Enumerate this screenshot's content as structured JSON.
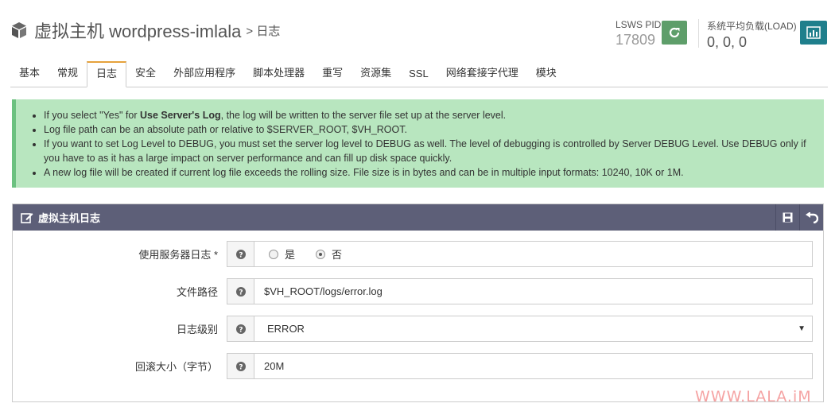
{
  "header": {
    "title": "虚拟主机 wordpress-imlala",
    "sub": "> 日志",
    "pid_label": "LSWS PID",
    "pid_value": "17809",
    "load_label": "系统平均负载(LOAD)",
    "load_value": "0, 0, 0"
  },
  "tabs": [
    {
      "label": "基本"
    },
    {
      "label": "常规"
    },
    {
      "label": "日志"
    },
    {
      "label": "安全"
    },
    {
      "label": "外部应用程序"
    },
    {
      "label": "脚本处理器"
    },
    {
      "label": "重写"
    },
    {
      "label": "资源集"
    },
    {
      "label": "SSL"
    },
    {
      "label": "网络套接字代理"
    },
    {
      "label": "模块"
    }
  ],
  "info": {
    "line1_pre": "If you select \"Yes\" for ",
    "line1_bold": "Use Server's Log",
    "line1_post": ", the log will be written to the server file set up at the server level.",
    "line2": "Log file path can be an absolute path or relative to $SERVER_ROOT, $VH_ROOT.",
    "line3": "If you want to set Log Level to DEBUG, you must set the server log level to DEBUG as well. The level of debugging is controlled by Server DEBUG Level. Use DEBUG only if you have to as it has a large impact on server performance and can fill up disk space quickly.",
    "line4": "A new log file will be created if current log file exceeds the rolling size. File size is in bytes and can be in multiple input formats: 10240, 10K or 1M."
  },
  "panel": {
    "title": "虚拟主机日志",
    "rows": {
      "use_server_log": {
        "label": "使用服务器日志 *",
        "opt_yes": "是",
        "opt_no": "否",
        "selected": "否"
      },
      "file_path": {
        "label": "文件路径",
        "value": "$VH_ROOT/logs/error.log"
      },
      "log_level": {
        "label": "日志级别",
        "value": "ERROR"
      },
      "rolling_size": {
        "label": "回滚大小（字节）",
        "value": "20M"
      }
    }
  },
  "watermark": "WWW.LALA.iM",
  "colors": {
    "refresh_button": "#5e9e6a",
    "chart_button": "#1f7f8c",
    "info_bg": "#b8e6bf",
    "panel_header": "#5d5f78",
    "tab_active_border": "#e6a23c"
  }
}
